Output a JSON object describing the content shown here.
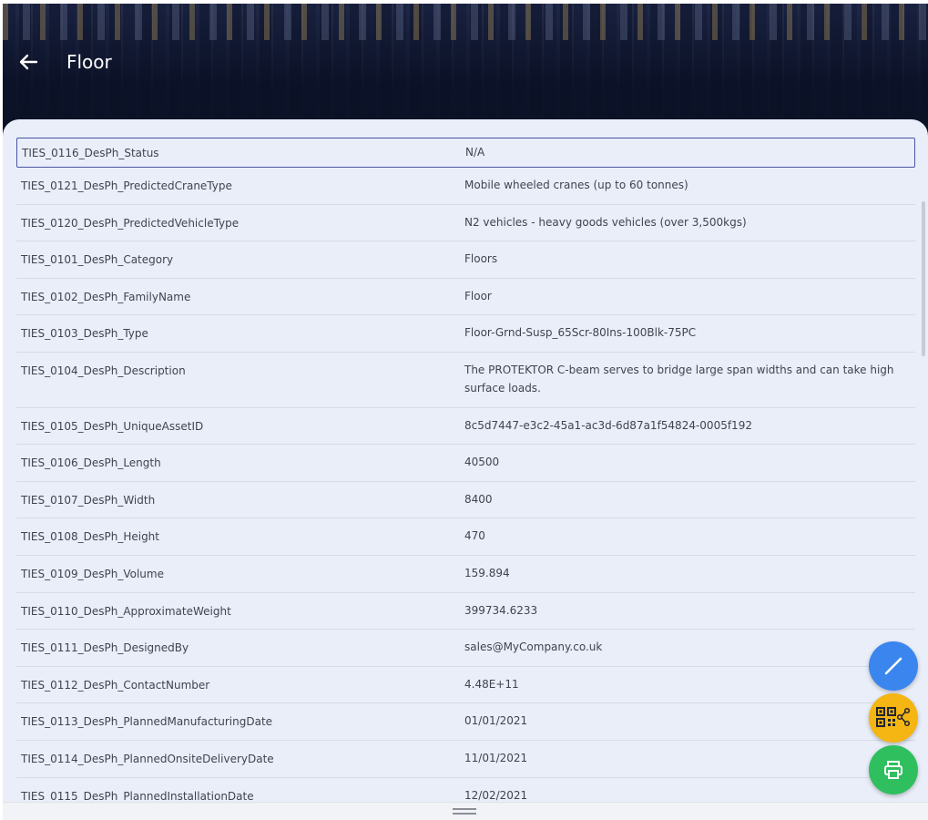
{
  "header": {
    "title": "Floor"
  },
  "properties": [
    {
      "key": "TIES_0116_DesPh_Status",
      "value": "N/A"
    },
    {
      "key": "TIES_0121_DesPh_PredictedCraneType",
      "value": "Mobile wheeled cranes (up to 60 tonnes)"
    },
    {
      "key": "TIES_0120_DesPh_PredictedVehicleType",
      "value": "N2 vehicles - heavy goods vehicles (over 3,500kgs)"
    },
    {
      "key": "TIES_0101_DesPh_Category",
      "value": "Floors"
    },
    {
      "key": "TIES_0102_DesPh_FamilyName",
      "value": "Floor"
    },
    {
      "key": "TIES_0103_DesPh_Type",
      "value": "Floor-Grnd-Susp_65Scr-80Ins-100Blk-75PC"
    },
    {
      "key": "TIES_0104_DesPh_Description",
      "value": "The PROTEKTOR C-beam serves to bridge large span widths and can take high surface loads."
    },
    {
      "key": "TIES_0105_DesPh_UniqueAssetID",
      "value": "8c5d7447-e3c2-45a1-ac3d-6d87a1f54824-0005f192"
    },
    {
      "key": "TIES_0106_DesPh_Length",
      "value": "40500"
    },
    {
      "key": "TIES_0107_DesPh_Width",
      "value": "8400"
    },
    {
      "key": "TIES_0108_DesPh_Height",
      "value": "470"
    },
    {
      "key": "TIES_0109_DesPh_Volume",
      "value": "159.894"
    },
    {
      "key": "TIES_0110_DesPh_ApproximateWeight",
      "value": "399734.6233"
    },
    {
      "key": "TIES_0111_DesPh_DesignedBy",
      "value": "sales@MyCompany.co.uk"
    },
    {
      "key": "TIES_0112_DesPh_ContactNumber",
      "value": "4.48E+11"
    },
    {
      "key": "TIES_0113_DesPh_PlannedManufacturingDate",
      "value": "01/01/2021"
    },
    {
      "key": "TIES_0114_DesPh_PlannedOnsiteDeliveryDate",
      "value": "11/01/2021"
    },
    {
      "key": "TIES_0115_DesPh_PlannedInstallationDate",
      "value": "12/02/2021"
    }
  ],
  "icons": {
    "back": "arrow-left-icon",
    "edit": "pencil-icon",
    "share": "qr-share-icon",
    "print": "printer-icon"
  },
  "colors": {
    "edit_fab": "#3a86ee",
    "share_fab": "#f5b512",
    "print_fab": "#2fbf5f",
    "selected_row_border": "#4a54a6"
  }
}
